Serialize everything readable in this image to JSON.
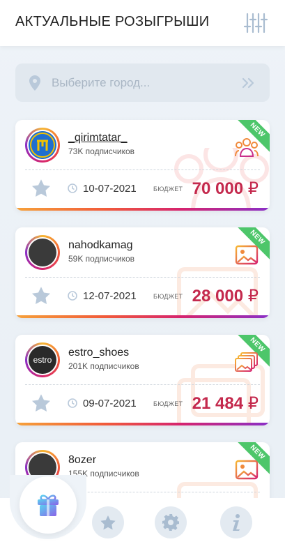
{
  "header": {
    "title": "АКТУАЛЬНЫЕ РОЗЫГРЫШИ"
  },
  "search": {
    "placeholder": "Выберите город..."
  },
  "budget_label": "БЮДЖЕТ",
  "cards": [
    {
      "username": "_qirimtatar_",
      "subscribers": "73K подписчиков",
      "date": "10-07-2021",
      "budget": "70 000",
      "currency": "₽",
      "badge": "NEW",
      "type_icon": "people-icon"
    },
    {
      "username": "nahodkamag",
      "subscribers": "59K подписчиков",
      "date": "12-07-2021",
      "budget": "28 000",
      "currency": "₽",
      "badge": "NEW",
      "type_icon": "image-icon"
    },
    {
      "username": "estro_shoes",
      "subscribers": "201K подписчиков",
      "date": "09-07-2021",
      "budget": "21 484",
      "currency": "₽",
      "badge": "NEW",
      "type_icon": "gallery-icon",
      "avatar_text": "estro"
    },
    {
      "username": "8ozer",
      "subscribers": "155K подписчиков",
      "date": "",
      "budget": "",
      "currency": "",
      "badge": "NEW",
      "type_icon": "image-icon"
    }
  ],
  "colors": {
    "accent": "#c4294d",
    "badge": "#4dc66a",
    "icon": "#b9c9da"
  }
}
